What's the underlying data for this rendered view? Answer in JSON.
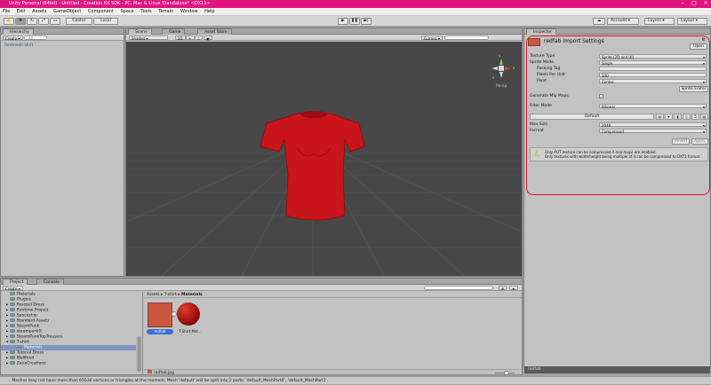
{
  "window": {
    "title": "Unity Personal (64bit) - Untitled - Creation Kit SDK - PC, Mac & Linux Standalone* <DX11>"
  },
  "menu": [
    "File",
    "Edit",
    "Assets",
    "GameObject",
    "Component",
    "Space",
    "Tools",
    "Terrain",
    "Window",
    "Help"
  ],
  "toolbar": {
    "pivot_label": "Center",
    "space_label": "Local",
    "account_label": "Account",
    "layers_label": "Layers",
    "layout_label": "Layout"
  },
  "hierarchy": {
    "tab": "Hierarchy",
    "create_label": "Create",
    "search_placeholder": "All",
    "items": [
      "Redmesh shirt"
    ]
  },
  "scene": {
    "tabs": [
      "Scene",
      "Game",
      "Asset Store"
    ],
    "shading_label": "Shaded",
    "mode_2d": "2D",
    "gizmos_label": "Gizmos",
    "gizmo_persp": "Persp",
    "gizmo_axes": {
      "y": "y",
      "x": "x",
      "z": "z"
    },
    "shirt_color": "#c8141a"
  },
  "inspector": {
    "tab": "Inspector",
    "title": "redfab Import Settings",
    "open_label": "Open",
    "rows": [
      {
        "label": "Texture Type",
        "value": "Sprite (2D and UI)"
      },
      {
        "label": "Sprite Mode",
        "value": "Single"
      },
      {
        "label": "Packing Tag",
        "value": ""
      },
      {
        "label": "Pixels Per Unit",
        "value": "100"
      },
      {
        "label": "Pivot",
        "value": "Center"
      }
    ],
    "sprite_editor_label": "Sprite Editor",
    "generate_mip_label": "Generate Mip Maps",
    "filter_mode_label": "Filter Mode",
    "filter_mode_value": "Bilinear",
    "platform_default": "Default",
    "max_size_label": "Max Size",
    "max_size_value": "2048",
    "format_label": "Format",
    "format_value": "Compressed",
    "revert_label": "Revert",
    "apply_label": "Apply",
    "warning_line1": "Only POT texture can be compressed if mip-maps are enabled",
    "warning_line2": "Only textures with width/height being multiple of 4 can be compressed to DXT1 format",
    "preview_label": "redfab"
  },
  "project": {
    "tabs": [
      "Project",
      "Console"
    ],
    "create_label": "Create",
    "tree": [
      "Materials",
      "Plugins",
      "Resized Dress",
      "Runtime Project",
      "Spaceship",
      "Standard Assets",
      "SteamPunk",
      "steampunk9",
      "SteamPunkTopTrousers",
      "T-shirt",
      "Materials",
      "Tutorial Dress",
      "Wellfired",
      "ZaneCreations"
    ],
    "breadcrumb": [
      "Assets",
      "T-shirt",
      "Materials"
    ],
    "assets": [
      {
        "name": "redfab",
        "selected": true
      },
      {
        "name": "T-Shirt Mat..."
      }
    ],
    "footer_file": "redfab.jpg"
  },
  "status": {
    "message": "Meshes may not have more than 65534 vertices or triangles at the moment. Mesh 'default' will be split into 2 parts: 'default_MeshPart0', 'default_MeshPart1'."
  }
}
